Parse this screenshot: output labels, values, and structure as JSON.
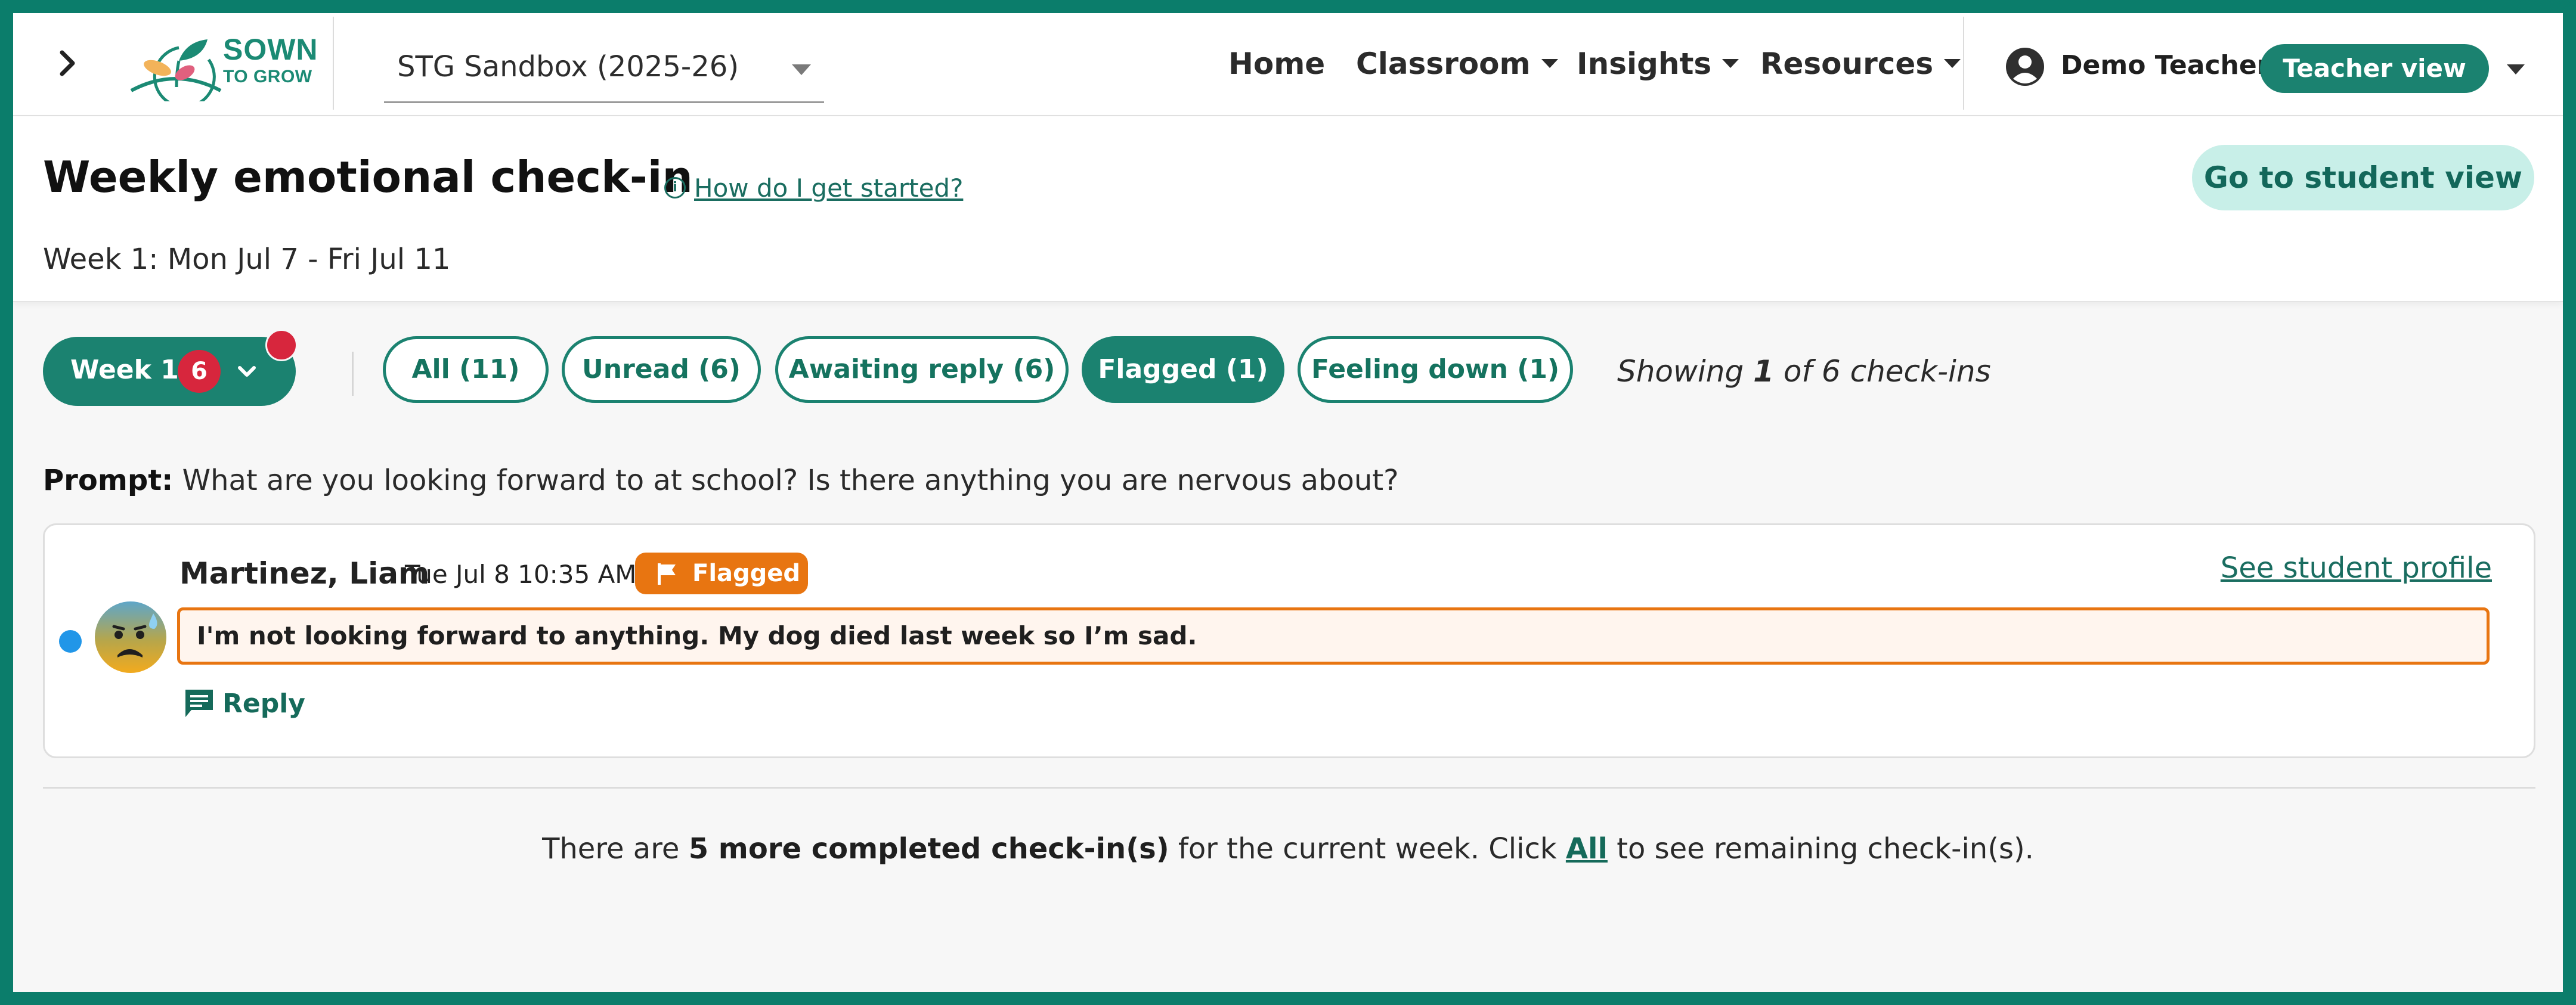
{
  "app": {
    "logo_line1": "SOWN",
    "logo_line2": "TO GROW",
    "accent_color": "#1b8270",
    "frame_color": "#0b7d6b"
  },
  "nav": {
    "toggle_icon": "chevron-right-icon",
    "class_select": {
      "value": "STG Sandbox (2025-26)"
    },
    "menu": [
      {
        "label": "Home",
        "has_dropdown": false
      },
      {
        "label": "Classroom",
        "has_dropdown": true
      },
      {
        "label": "Insights",
        "has_dropdown": true
      },
      {
        "label": "Resources",
        "has_dropdown": true
      }
    ],
    "user": {
      "icon": "user-circle-icon",
      "name": "Demo Teacher",
      "role_badge": "Teacher view"
    }
  },
  "header": {
    "title": "Weekly emotional check-in",
    "help_link": "How do I get started?",
    "student_view_button": "Go to student view",
    "week_range": "Week 1: Mon Jul 7 - Fri Jul 11"
  },
  "filters": {
    "week": {
      "label": "Week 1",
      "badge": "6"
    },
    "chips": [
      {
        "label": "All (11)",
        "active": false
      },
      {
        "label": "Unread (6)",
        "active": false
      },
      {
        "label": "Awaiting reply (6)",
        "active": false
      },
      {
        "label": "Flagged (1)",
        "active": true
      },
      {
        "label": "Feeling down (1)",
        "active": false
      }
    ],
    "showing_prefix": "Showing ",
    "showing_count": "1",
    "showing_suffix": " of 6 check-ins"
  },
  "prompt": {
    "label": "Prompt:",
    "text": " What are you looking forward to at school? Is there anything you are nervous about?"
  },
  "checkin": {
    "student_name": "Martinez, Liam",
    "timestamp": "Tue Jul 8 10:35 AM",
    "flag_label": "Flagged",
    "profile_link": "See student profile",
    "message": "I'm not looking forward to anything. My dog died last week so I’m sad.",
    "reply_label": "Reply",
    "flag_color": "#e87511",
    "unread_dot_color": "#2196e8",
    "emotion_icon": "sad-sweat-face-icon"
  },
  "footer": {
    "prefix": "There are ",
    "bold": "5 more completed check-in(s)",
    "middle": " for the current week. Click ",
    "link": "All",
    "suffix": " to see remaining check-in(s)."
  }
}
